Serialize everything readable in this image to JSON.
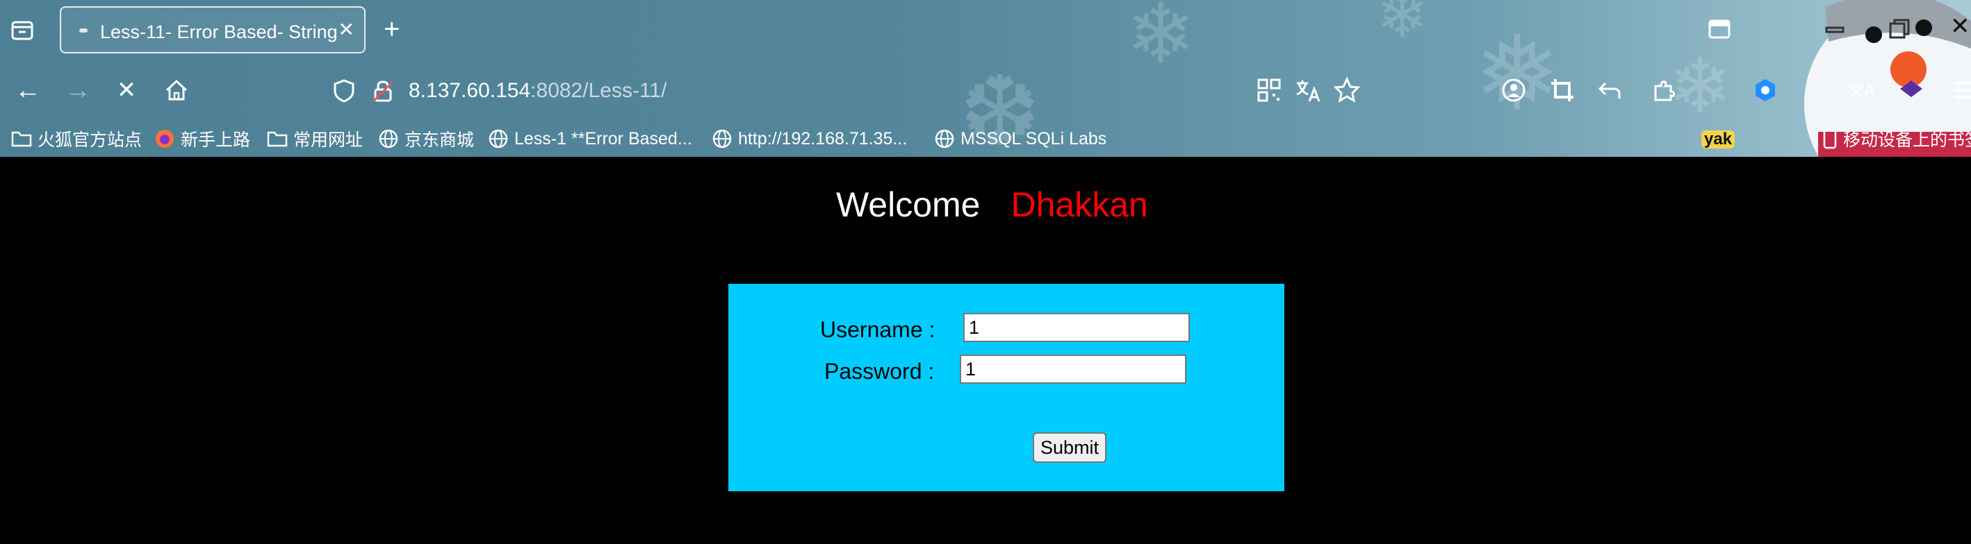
{
  "browser": {
    "tab": {
      "title": "Less-11- Error Based- String"
    },
    "address": {
      "host": "8.137.60.154",
      "path": ":8082/Less-11/"
    },
    "extension_label": "yak",
    "bookmarks": [
      {
        "label": "火狐官方站点",
        "icon": "folder-icon"
      },
      {
        "label": "新手上路",
        "icon": "firefox-icon"
      },
      {
        "label": "常用网址",
        "icon": "folder-icon"
      },
      {
        "label": "京东商城",
        "icon": "globe-icon"
      },
      {
        "label": "Less-1 **Error Based...",
        "icon": "globe-icon"
      },
      {
        "label": "http://192.168.71.35...",
        "icon": "globe-icon"
      },
      {
        "label": "MSSQL SQLi Labs",
        "icon": "globe-icon"
      }
    ],
    "mobile_bookmarks": "移动设备上的书签"
  },
  "page": {
    "welcome": "Welcome",
    "username_highlight": "Dhakkan",
    "form": {
      "username_label": "Username :",
      "username_value": "1",
      "password_label": "Password :",
      "password_value": "1",
      "submit_label": "Submit"
    }
  },
  "colors": {
    "page_bg": "#000000",
    "form_bg": "#00ccff",
    "highlight": "#ff0000"
  }
}
